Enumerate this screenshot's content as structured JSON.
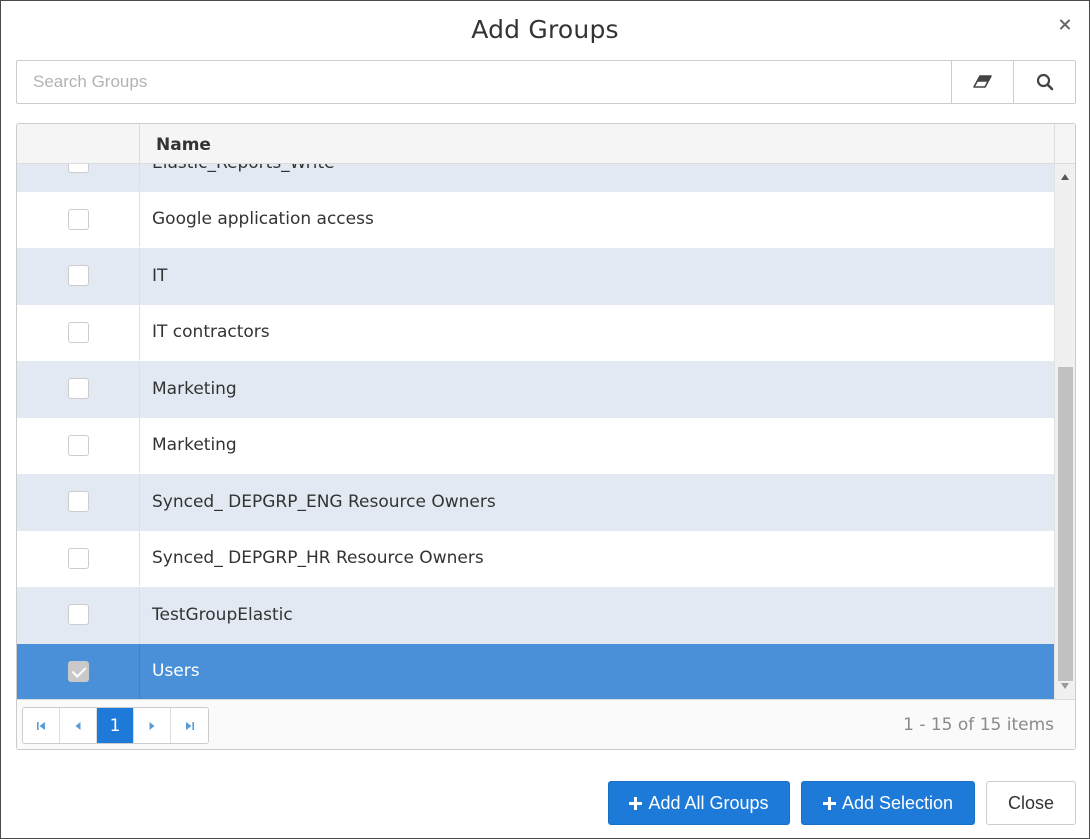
{
  "dialog": {
    "title": "Add Groups",
    "close_icon": "close-icon"
  },
  "search": {
    "placeholder": "Search Groups",
    "value": "",
    "clear_icon": "eraser-icon",
    "search_icon": "search-icon"
  },
  "grid": {
    "columns": {
      "name": "Name"
    },
    "rows": [
      {
        "name": "Elastic_Reports_Write",
        "checked": false
      },
      {
        "name": "Google application access",
        "checked": false
      },
      {
        "name": "IT",
        "checked": false
      },
      {
        "name": "IT contractors",
        "checked": false
      },
      {
        "name": "Marketing",
        "checked": false
      },
      {
        "name": "Marketing",
        "checked": false
      },
      {
        "name": "Synced_ DEPGRP_ENG Resource Owners",
        "checked": false
      },
      {
        "name": "Synced_ DEPGRP_HR Resource Owners",
        "checked": false
      },
      {
        "name": "TestGroupElastic",
        "checked": false
      },
      {
        "name": "Users",
        "checked": true
      }
    ]
  },
  "pager": {
    "current_page": "1",
    "info": "1 - 15 of 15 items",
    "icons": [
      "first-page-icon",
      "prev-page-icon",
      "next-page-icon",
      "last-page-icon"
    ]
  },
  "footer": {
    "add_all_label": "Add All Groups",
    "add_selection_label": "Add Selection",
    "close_label": "Close"
  },
  "colors": {
    "primary": "#1e7ad8",
    "selected_row": "#4a90d9",
    "alt_row": "#e3e9f2"
  }
}
